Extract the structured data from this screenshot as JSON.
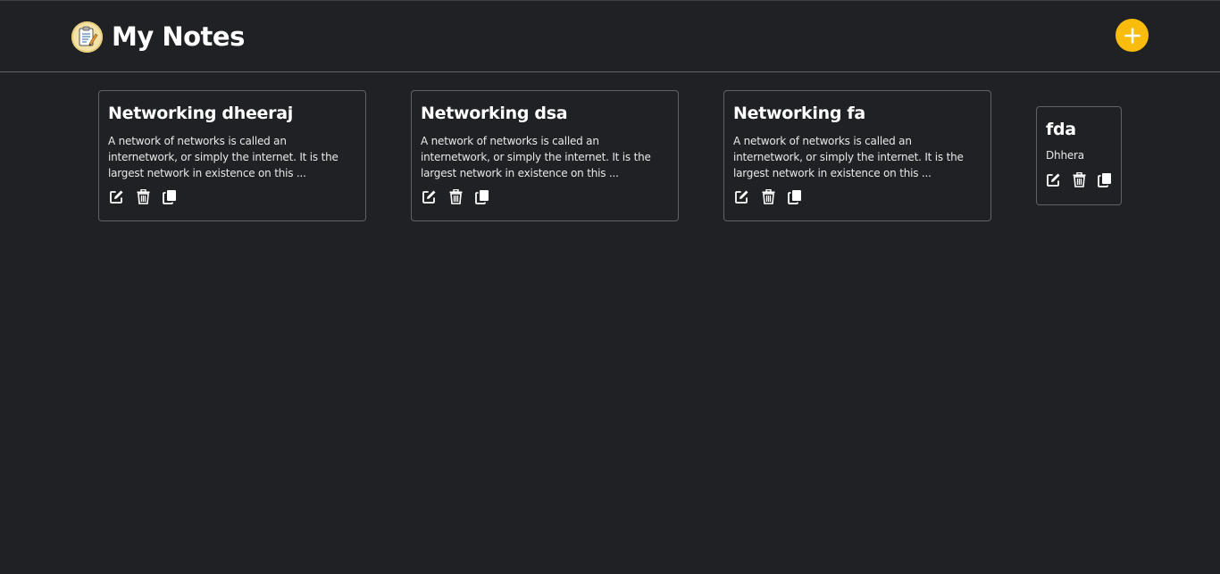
{
  "app": {
    "title": "My Notes",
    "logo_icon": "notepad-icon",
    "add_icon": "plus-icon",
    "accent_color": "#f9bb0c",
    "background_color": "#202124"
  },
  "notes": [
    {
      "title": "Networking dheeraj",
      "body": "A network of networks is called an internetwork, or simply the internet. It is the largest network in existence on this ..."
    },
    {
      "title": "Networking dsa",
      "body": "A network of networks is called an internetwork, or simply the internet. It is the largest network in existence on this ..."
    },
    {
      "title": "Networking fa",
      "body": "A network of networks is called an internetwork, or simply the internet. It is the largest network in existence on this ..."
    },
    {
      "title": "fda",
      "body": "Dhhera"
    }
  ],
  "note_actions": [
    "edit-icon",
    "trash-icon",
    "copy-icon"
  ]
}
